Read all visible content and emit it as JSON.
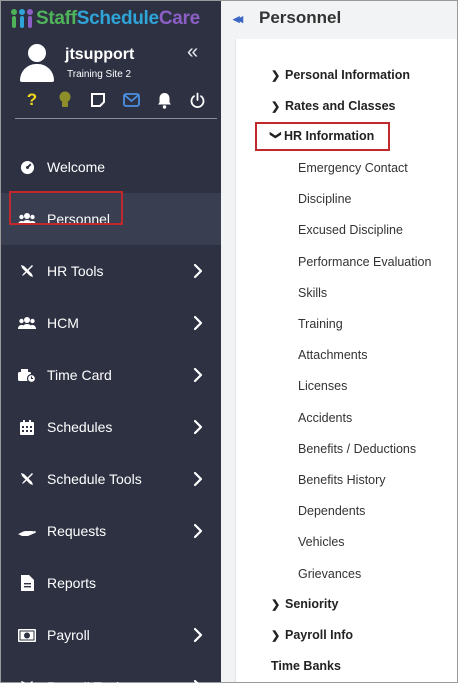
{
  "brand": {
    "part1": "Staff",
    "part2": "Schedule",
    "part3": "Care",
    "colors": {
      "green": "#4fb35a",
      "blue": "#2fa4d8",
      "purple": "#8c5fc6"
    }
  },
  "user": {
    "name": "jtsupport",
    "site": "Training Site 2"
  },
  "status_icons": [
    {
      "name": "help-icon",
      "glyph": "?",
      "color": "#f0d81d"
    },
    {
      "name": "lightbulb-icon",
      "glyph": "",
      "color": "#9a9a2a"
    },
    {
      "name": "note-icon",
      "glyph": "",
      "color": "#ffffff"
    },
    {
      "name": "mail-icon",
      "glyph": "",
      "color": "#4a90e2"
    },
    {
      "name": "bell-icon",
      "glyph": "",
      "color": "#ffffff"
    },
    {
      "name": "power-icon",
      "glyph": "",
      "color": "#ffffff"
    }
  ],
  "nav": [
    {
      "label": "Welcome",
      "icon": "dashboard-icon",
      "chevron": false
    },
    {
      "label": "Personnel",
      "icon": "users-icon",
      "chevron": false,
      "active": true
    },
    {
      "label": "HR Tools",
      "icon": "tools-icon",
      "chevron": true
    },
    {
      "label": "HCM",
      "icon": "users-icon",
      "chevron": true
    },
    {
      "label": "Time Card",
      "icon": "clock-card-icon",
      "chevron": true
    },
    {
      "label": "Schedules",
      "icon": "calendar-icon",
      "chevron": true
    },
    {
      "label": "Schedule Tools",
      "icon": "tools-icon",
      "chevron": true
    },
    {
      "label": "Requests",
      "icon": "hand-icon",
      "chevron": true
    },
    {
      "label": "Reports",
      "icon": "report-icon",
      "chevron": false
    },
    {
      "label": "Payroll",
      "icon": "money-icon",
      "chevron": true
    },
    {
      "label": "Payroll Tools",
      "icon": "tools-icon",
      "chevron": true
    }
  ],
  "main": {
    "title": "Personnel",
    "tree": {
      "personal_info": "Personal Information",
      "rates": "Rates and Classes",
      "hr_info": "HR Information",
      "hr_children": [
        "Emergency Contact",
        "Discipline",
        "Excused Discipline",
        "Performance Evaluation",
        "Skills",
        "Training",
        "Attachments",
        "Licenses",
        "Accidents",
        "Benefits / Deductions",
        "Benefits History",
        "Dependents",
        "Vehicles",
        "Grievances"
      ],
      "seniority": "Seniority",
      "payroll_info": "Payroll Info",
      "time_banks": "Time Banks"
    }
  },
  "highlight_color": "#c0282c"
}
